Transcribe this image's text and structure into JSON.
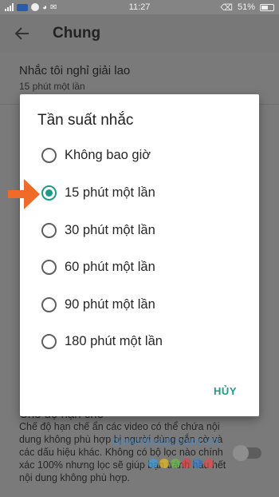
{
  "statusbar": {
    "time": "11:27",
    "battery": "51%",
    "left_icons": [
      "signal-icon",
      "carrier-icon",
      "messenger-icon",
      "wifi-icon",
      "message-icon"
    ],
    "right_icons": [
      "silent-icon",
      "battery-icon"
    ]
  },
  "toolbar": {
    "title": "Chung",
    "back_icon": "arrow-back-icon"
  },
  "settings": {
    "remind_break": {
      "title": "Nhắc tôi nghỉ giải lao",
      "value": "15 phút một lần"
    },
    "restricted_mode": {
      "title": "Chế độ hạn chế",
      "description": "Chế độ hạn chế ẩn các video có thể chứa nội dung không phù hợp bị người dùng gắn cờ và các dấu hiệu khác. Không có bộ lọc nào chính xác 100% nhưng lọc sẽ giúp bạn tránh hầu hết nội dung không phù hợp.",
      "enabled": false
    }
  },
  "dialog": {
    "title": "Tần suất nhắc",
    "options": [
      {
        "label": "Không bao giờ",
        "selected": false
      },
      {
        "label": "15 phút một lần",
        "selected": true
      },
      {
        "label": "30 phút một lần",
        "selected": false
      },
      {
        "label": "60 phút một lần",
        "selected": false
      },
      {
        "label": "90 phút một lần",
        "selected": false
      },
      {
        "label": "180 phút một lần",
        "selected": false
      }
    ],
    "cancel_label": "HỦY"
  },
  "watermark": {
    "text": "download.com.vn"
  },
  "colors": {
    "accent": "#1a9c8a",
    "arrow": "#f06a28",
    "scrim": "#7a7a7a"
  }
}
